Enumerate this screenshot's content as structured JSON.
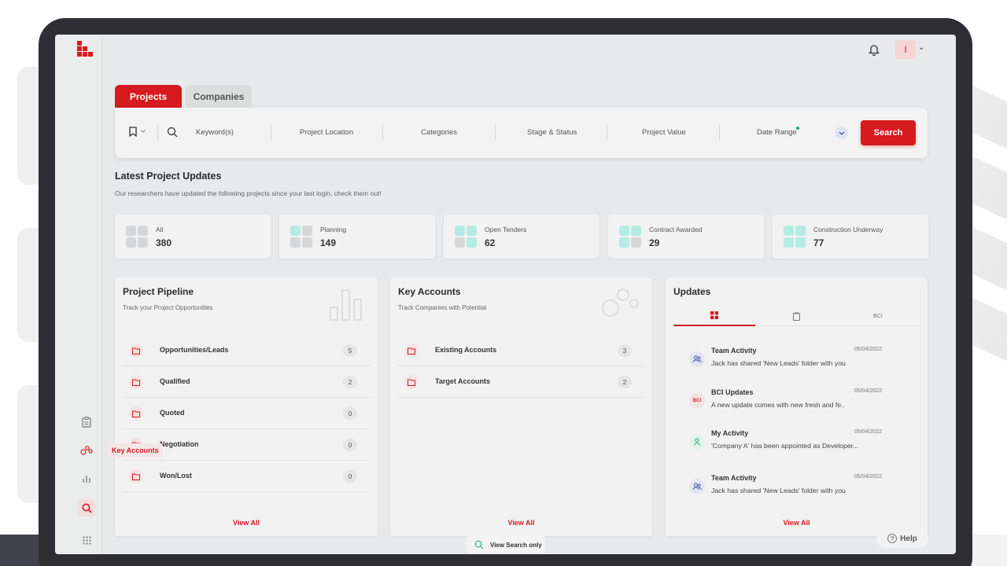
{
  "header": {
    "avatar_initial": "I",
    "avatar_chevron": "⌄"
  },
  "tabs": [
    {
      "label": "Projects",
      "active": true
    },
    {
      "label": "Companies",
      "active": false
    }
  ],
  "search_bar": {
    "fields": [
      "Keyword(s)",
      "Project Location",
      "Categories",
      "Stage & Status",
      "Project Value",
      "Date Range"
    ],
    "button_label": "Search"
  },
  "latest_updates": {
    "title": "Latest Project Updates",
    "subtitle": "Our researchers have updated the following projects since your last login, check them out!",
    "stats": [
      {
        "label": "All",
        "value": "380"
      },
      {
        "label": "Planning",
        "value": "149"
      },
      {
        "label": "Open Tenders",
        "value": "62"
      },
      {
        "label": "Contract Awarded",
        "value": "29"
      },
      {
        "label": "Construction Underway",
        "value": "77"
      }
    ]
  },
  "pipeline": {
    "title": "Project Pipeline",
    "subtitle": "Track your Project Opportunities",
    "items": [
      {
        "label": "Opportunities/Leads",
        "count": "5"
      },
      {
        "label": "Qualified",
        "count": "2"
      },
      {
        "label": "Quoted",
        "count": "0"
      },
      {
        "label": "Negotiation",
        "count": "0"
      },
      {
        "label": "Won/Lost",
        "count": "0"
      }
    ],
    "view_all": "View All"
  },
  "key_accounts": {
    "title": "Key Accounts",
    "subtitle": "Track Companies with Potential",
    "items": [
      {
        "label": "Existing Accounts",
        "count": "3"
      },
      {
        "label": "Target Accounts",
        "count": "2"
      }
    ],
    "view_all": "View All"
  },
  "updates": {
    "title": "Updates",
    "tab_bci": "BCI",
    "items": [
      {
        "title": "Team Activity",
        "text": "Jack has shared 'New Leads' folder with you",
        "date": "05/04/2022",
        "avatar": "team-icon"
      },
      {
        "title": "BCI Updates",
        "text": "A new update comes with new fresh and  fe..",
        "date": "05/04/2022",
        "avatar": "BCI"
      },
      {
        "title": "My Activity",
        "text": "'Company A' has been appointed as Developer...",
        "date": "05/04/2022",
        "avatar": "user-icon"
      },
      {
        "title": "Team Activity",
        "text": "Jack has shared 'New Leads' folder with you",
        "date": "05/04/2022",
        "avatar": "team-icon"
      }
    ],
    "view_all": "View All"
  },
  "sidebar": {
    "tooltip": "Key Accounts"
  },
  "footer": {
    "view_search": "View Search only",
    "help": "Help"
  },
  "colors": {
    "brand_red": "#d71920",
    "teal_accent": "#b4ece4",
    "status_dot": "#1fa37a"
  }
}
